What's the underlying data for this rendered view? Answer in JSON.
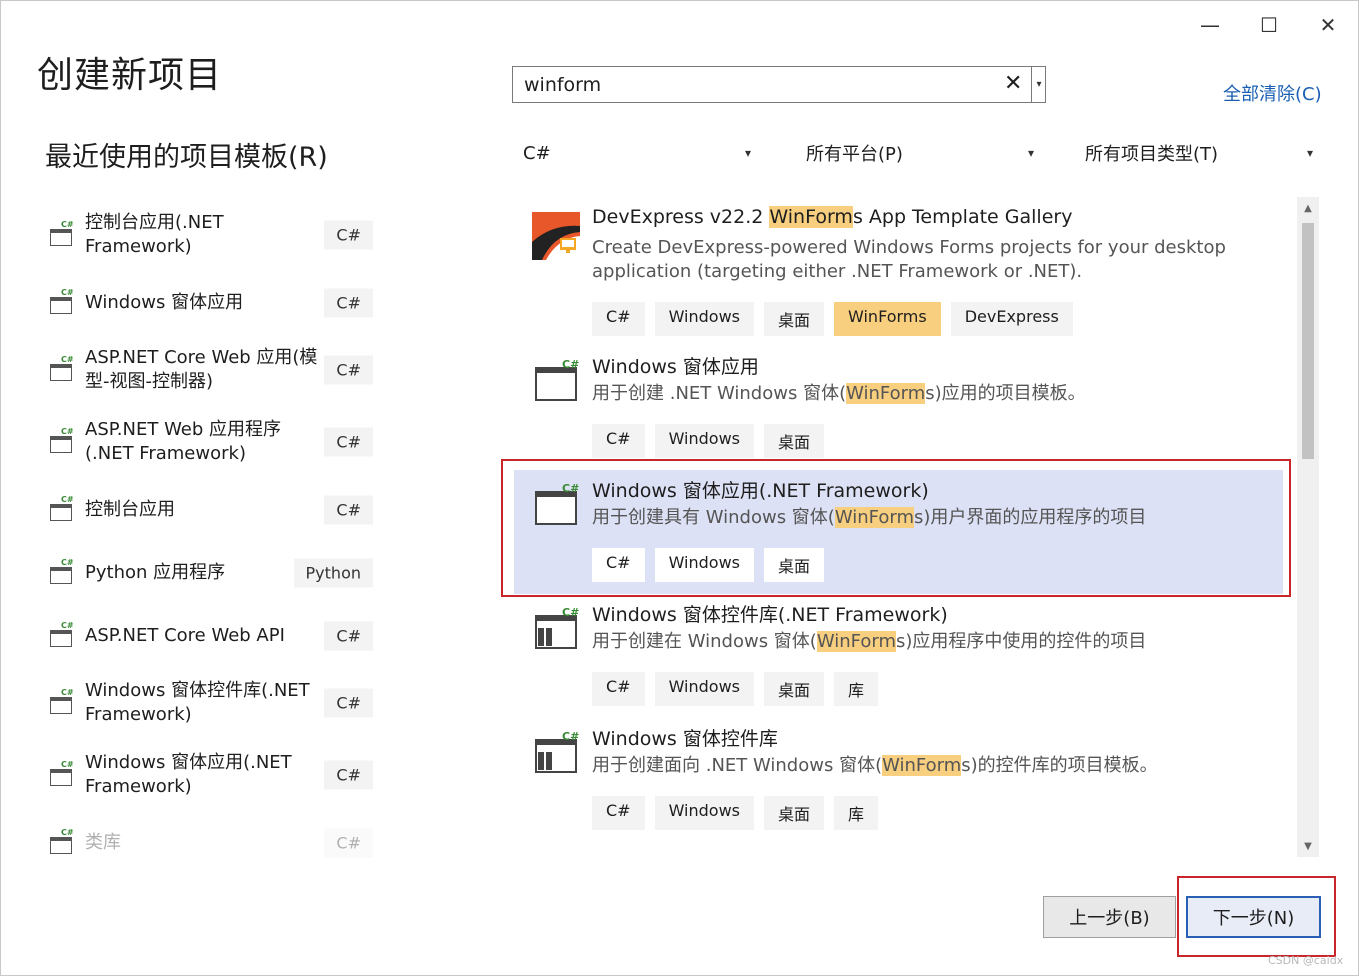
{
  "window": {
    "title": "创建新项目",
    "controls": {
      "minimize": "—",
      "maximize": "☐",
      "close": "✕"
    }
  },
  "recent": {
    "title": "最近使用的项目模板(R)",
    "items": [
      {
        "label": "控制台应用(.NET Framework)",
        "lang": "C#",
        "icon": "console-icon"
      },
      {
        "label": "Windows 窗体应用",
        "lang": "C#",
        "icon": "winform-icon"
      },
      {
        "label": "ASP.NET Core Web 应用(模型-视图-控制器)",
        "lang": "C#",
        "icon": "web-globe-icon"
      },
      {
        "label": "ASP.NET Web 应用程序(.NET Framework)",
        "lang": "C#",
        "icon": "web-app-icon"
      },
      {
        "label": "控制台应用",
        "lang": "C#",
        "icon": "console-icon"
      },
      {
        "label": "Python 应用程序",
        "lang": "Python",
        "icon": "python-icon"
      },
      {
        "label": "ASP.NET Core Web API",
        "lang": "C#",
        "icon": "api-icon"
      },
      {
        "label": "Windows 窗体控件库(.NET Framework)",
        "lang": "C#",
        "icon": "control-library-icon"
      },
      {
        "label": "Windows 窗体应用(.NET Framework)",
        "lang": "C#",
        "icon": "winform-icon"
      },
      {
        "label": "类库",
        "lang": "C#",
        "icon": "class-library-icon"
      }
    ]
  },
  "search": {
    "value": "winform",
    "clear": "✕",
    "dropdown": "▾"
  },
  "clear_all": "全部清除(C)",
  "filters": {
    "language": "C#",
    "platform": "所有平台(P)",
    "project_type": "所有项目类型(T)"
  },
  "results": [
    {
      "title_pre": "DevExpress v22.2 ",
      "title_hl": "WinForm",
      "title_post": "s App Template Gallery",
      "desc_pre": "Create DevExpress-powered Windows Forms projects for your desktop application (targeting either .NET Framework or .NET).",
      "desc_hl": "",
      "desc_post": "",
      "tags": [
        "C#",
        "Windows",
        "桌面",
        "WinForms",
        "DevExpress"
      ],
      "selected": false
    },
    {
      "title_pre": "Windows 窗体应用",
      "title_hl": "",
      "title_post": "",
      "desc_pre": "用于创建 .NET Windows 窗体(",
      "desc_hl": "WinForm",
      "desc_post": "s)应用的项目模板。",
      "tags": [
        "C#",
        "Windows",
        "桌面"
      ],
      "selected": false
    },
    {
      "title_pre": "Windows 窗体应用(.NET Framework)",
      "title_hl": "",
      "title_post": "",
      "desc_pre": "用于创建具有 Windows 窗体(",
      "desc_hl": "WinForm",
      "desc_post": "s)用户界面的应用程序的项目",
      "tags": [
        "C#",
        "Windows",
        "桌面"
      ],
      "selected": true
    },
    {
      "title_pre": "Windows 窗体控件库(.NET Framework)",
      "title_hl": "",
      "title_post": "",
      "desc_pre": "用于创建在 Windows 窗体(",
      "desc_hl": "WinForm",
      "desc_post": "s)应用程序中使用的控件的项目",
      "tags": [
        "C#",
        "Windows",
        "桌面",
        "库"
      ],
      "selected": false
    },
    {
      "title_pre": "Windows 窗体控件库",
      "title_hl": "",
      "title_post": "",
      "desc_pre": "用于创建面向 .NET Windows 窗体(",
      "desc_hl": "WinForm",
      "desc_post": "s)的控件库的项目模板。",
      "tags": [
        "C#",
        "Windows",
        "桌面",
        "库"
      ],
      "selected": false
    }
  ],
  "buttons": {
    "back": "上一步(B)",
    "next": "下一步(N)"
  },
  "watermark": "CSDN @caidx",
  "colors": {
    "accent": "#2b5fb4",
    "selected_bg": "#dde1f5",
    "highlight": "#f7cf7f",
    "annotation": "#c8262b"
  }
}
